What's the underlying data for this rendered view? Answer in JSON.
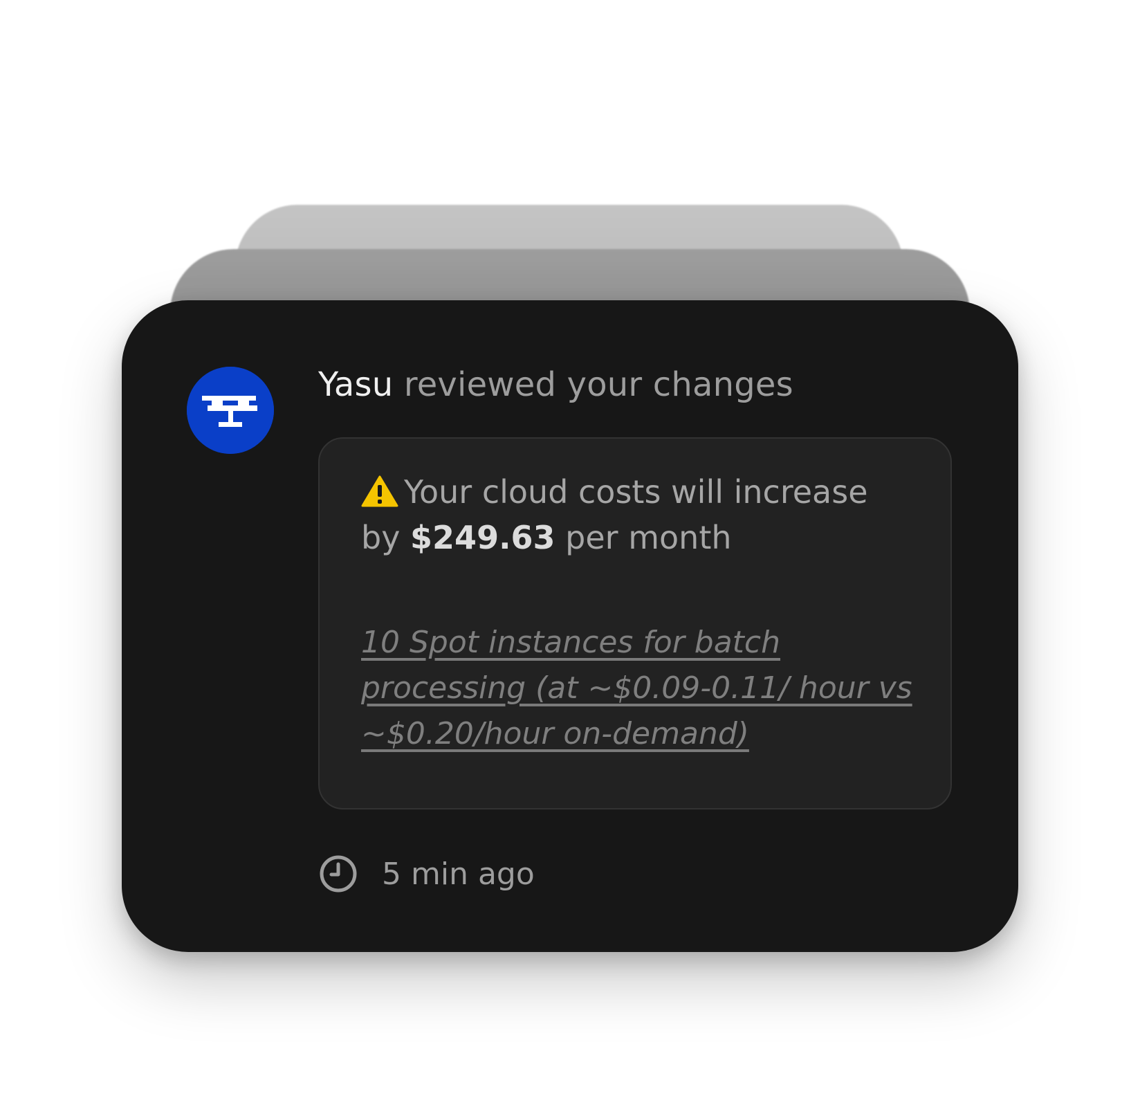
{
  "notification": {
    "actor": "Yasu",
    "action": " reviewed your changes",
    "avatar_icon": "yasu-logo-icon",
    "avatar_color": "#0a3fc8",
    "alert": {
      "icon": "warning-icon",
      "text_before": "Your cloud costs will increase by ",
      "amount": "$249.63",
      "text_after": " per month",
      "detail_link": "10 Spot instances for batch processing (at ~$0.09-0.11/ hour vs ~$0.20/hour on-demand)"
    },
    "time_icon": "clock-icon",
    "timestamp": "5 min ago"
  }
}
